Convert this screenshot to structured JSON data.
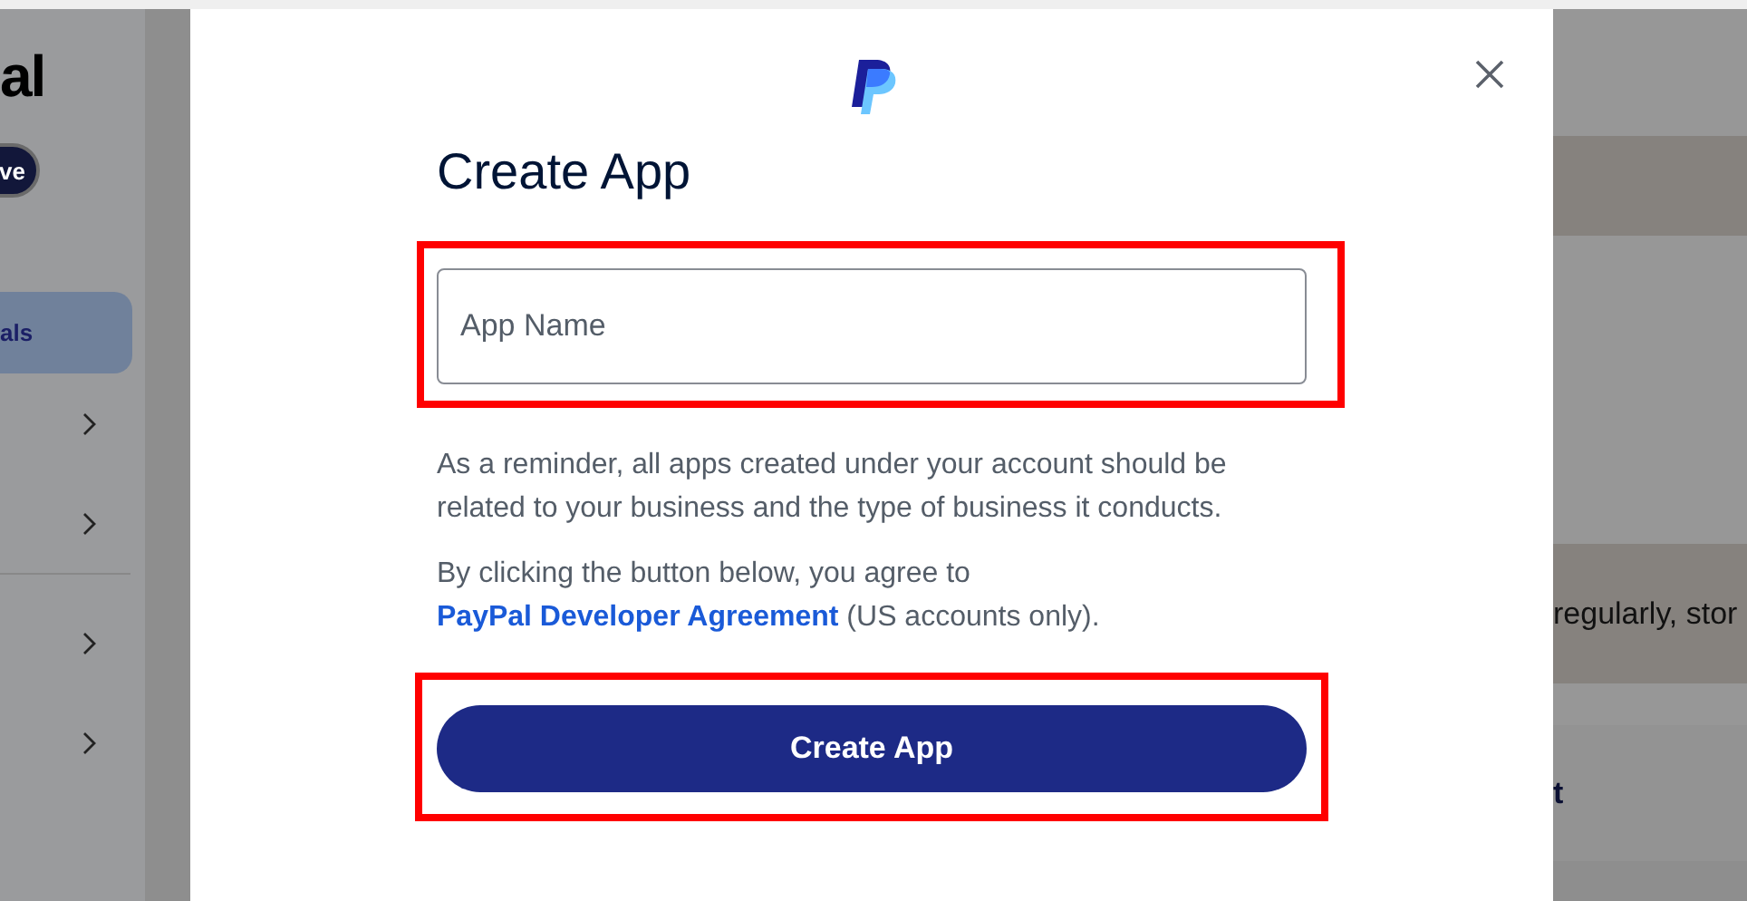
{
  "background": {
    "logo_text": "al",
    "badge": "ve",
    "nav_groups": [
      [
        {
          "kind": "label",
          "label": "als",
          "selected": true
        },
        {
          "kind": "chevron",
          "selected": false
        },
        {
          "kind": "chevron",
          "selected": false
        }
      ],
      [
        {
          "kind": "chevron",
          "selected": false
        },
        {
          "kind": "chevron",
          "selected": false
        }
      ]
    ],
    "snippet": "regularly, stor",
    "heading_fragment": "t"
  },
  "dialog": {
    "title": "Create App",
    "field": {
      "placeholder": "App Name",
      "highlighted": true
    },
    "reminder": "As a reminder, all apps created under your account should be related to your business and the type of business it conducts.",
    "agreement": {
      "before": "By clicking the button below, you agree to",
      "link": "PayPal Developer Agreement",
      "after": "(US accounts only)."
    },
    "button": {
      "label": "Create App",
      "highlighted": true
    }
  }
}
